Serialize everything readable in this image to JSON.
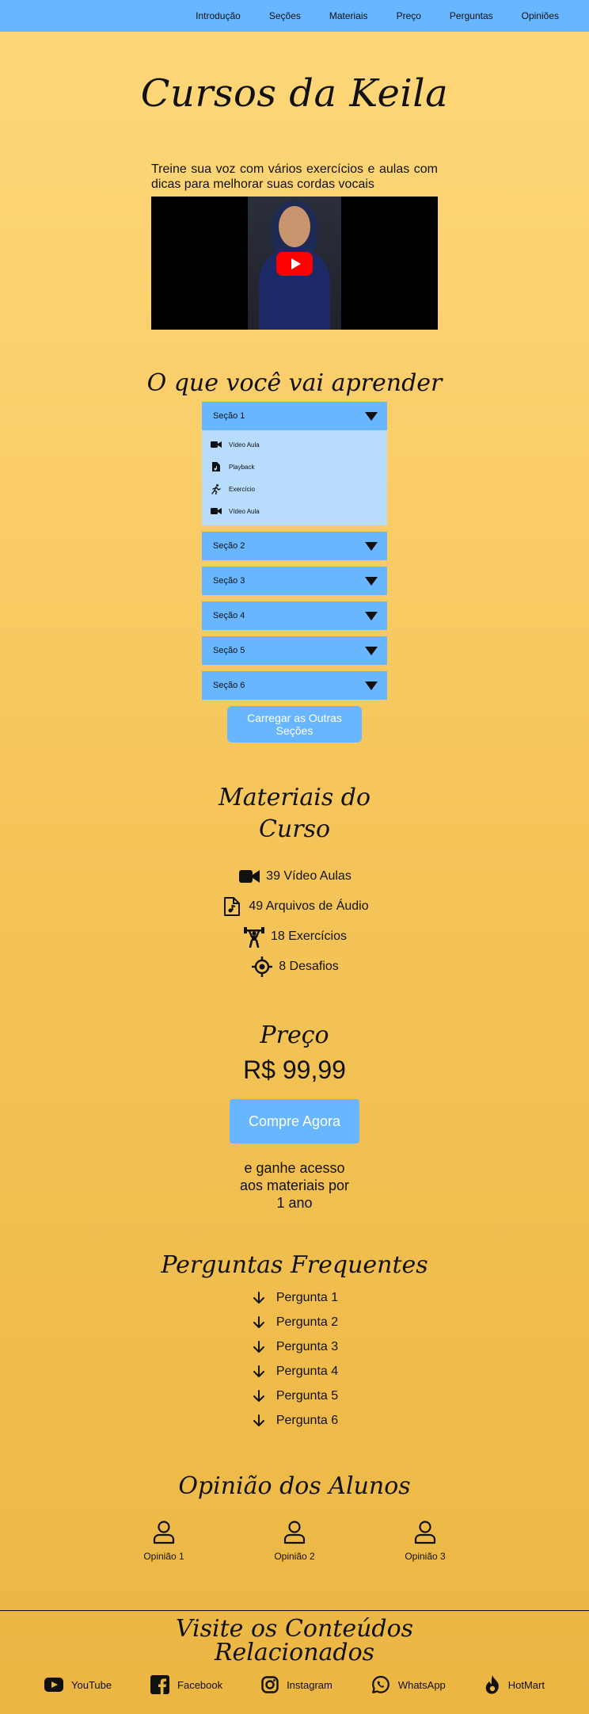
{
  "nav": {
    "items": [
      "Introdução",
      "Seções",
      "Materiais",
      "Preço",
      "Perguntas",
      "Opiniões"
    ]
  },
  "hero": {
    "title": "Cursos da Keila",
    "intro": "Treine sua voz com vários exercícios e aulas com dicas para melhorar suas cordas vocais"
  },
  "learn": {
    "title": "O que você vai aprender",
    "sections": [
      {
        "label": "Seção 1",
        "expanded": true,
        "items": [
          {
            "icon": "video-camera-icon",
            "label": "Vídeo Aula"
          },
          {
            "icon": "audio-file-icon",
            "label": "Playback"
          },
          {
            "icon": "running-person-icon",
            "label": "Exercício"
          },
          {
            "icon": "video-camera-icon",
            "label": "Vídeo Aula"
          }
        ]
      },
      {
        "label": "Seção 2",
        "expanded": false
      },
      {
        "label": "Seção 3",
        "expanded": false
      },
      {
        "label": "Seção 4",
        "expanded": false
      },
      {
        "label": "Seção 5",
        "expanded": false
      },
      {
        "label": "Seção 6",
        "expanded": false
      }
    ],
    "load_more": "Carregar as Outras Seções"
  },
  "materials": {
    "title_line1": "Materiais do",
    "title_line2": "Curso",
    "items": [
      {
        "icon": "video-camera-icon",
        "label": "39 Vídeo Aulas"
      },
      {
        "icon": "audio-file-icon",
        "label": "49 Arquivos de Áudio"
      },
      {
        "icon": "weightlifting-icon",
        "label": "18 Exercícios"
      },
      {
        "icon": "target-icon",
        "label": "8 Desafios"
      }
    ]
  },
  "pricing": {
    "title": "Preço",
    "price": "R$ 99,99",
    "buy": "Compre Agora",
    "bonus": "e ganhe acesso aos materiais por 1 ano"
  },
  "faq": {
    "title": "Perguntas Frequentes",
    "questions": [
      "Pergunta 1",
      "Pergunta 2",
      "Pergunta 3",
      "Pergunta 4",
      "Pergunta 5",
      "Pergunta 6"
    ]
  },
  "opinions": {
    "title": "Opinião dos Alunos",
    "items": [
      "Opinião 1",
      "Opinião 2",
      "Opinião 3"
    ]
  },
  "footer": {
    "title_line1": "Visite os Conteúdos",
    "title_line2": "Relacionados",
    "links": [
      {
        "icon": "youtube-icon",
        "label": "YouTube"
      },
      {
        "icon": "facebook-icon",
        "label": "Facebook"
      },
      {
        "icon": "instagram-icon",
        "label": "Instagram"
      },
      {
        "icon": "whatsapp-icon",
        "label": "WhatsApp"
      },
      {
        "icon": "hotmart-flame-icon",
        "label": "HotMart"
      }
    ]
  },
  "colors": {
    "nav_blue": "#67b6ff",
    "panel_light_blue": "#b8dcfb",
    "background_top": "#ffd87a",
    "background_bottom": "#ebb642",
    "youtube_red": "#ff0000"
  }
}
